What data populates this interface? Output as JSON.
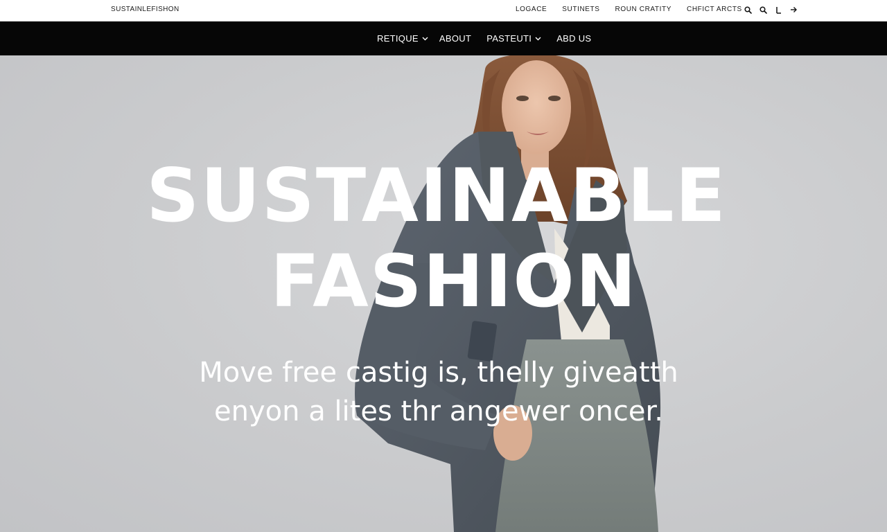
{
  "brand": "SUSTAINLEFISHON",
  "utility_links": [
    {
      "label": "LOGACE"
    },
    {
      "label": "SUTINETS"
    },
    {
      "label": "ROUN CRATITY"
    },
    {
      "label": "CHFICT ARCTS"
    }
  ],
  "utility_icons": [
    "search-icon",
    "search-icon",
    "user-icon",
    "arrow-right-icon"
  ],
  "nav": {
    "items": [
      {
        "label": "RETIQUE",
        "has_dropdown": true
      },
      {
        "label": "ABOUT",
        "has_dropdown": false
      },
      {
        "label": "PASTEUTI",
        "has_dropdown": true
      },
      {
        "label": "ABD US",
        "has_dropdown": false
      }
    ]
  },
  "hero": {
    "headline_line1": "SUSTAINABLE",
    "headline_line2": "FASHION",
    "tagline_line1": "Move free castig is, thelly giveatth",
    "tagline_line2": "enyon a lites thr angewer oncer."
  },
  "colors": {
    "nav_bg": "#060606",
    "topbar_bg": "#ffffff",
    "hero_bg": "#cacbcd",
    "hero_text": "#ffffff"
  }
}
